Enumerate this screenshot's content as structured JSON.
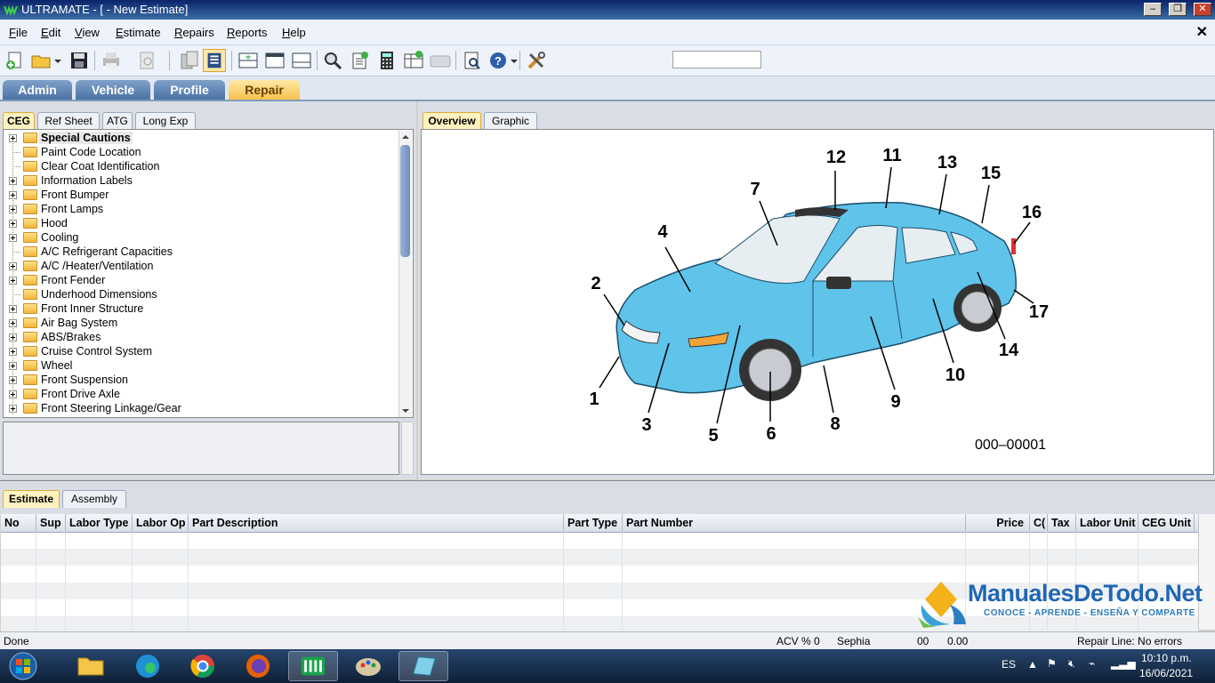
{
  "window": {
    "title": "ULTRAMATE - [ - New Estimate]"
  },
  "menu": [
    {
      "label": "File",
      "u": "F",
      "rest": "ile"
    },
    {
      "label": "Edit",
      "u": "E",
      "rest": "dit"
    },
    {
      "label": "View",
      "u": "V",
      "rest": "iew"
    },
    {
      "label": "Estimate",
      "u": "E",
      "rest": "stimate"
    },
    {
      "label": "Repairs",
      "u": "R",
      "rest": "epairs"
    },
    {
      "label": "Reports",
      "u": "R",
      "rest": "eports"
    },
    {
      "label": "Help",
      "u": "H",
      "rest": "elp"
    }
  ],
  "main_tabs": [
    "Admin",
    "Vehicle",
    "Profile",
    "Repair"
  ],
  "main_tab_active": "Repair",
  "left_tabs": [
    "CEG",
    "Ref Sheet",
    "ATG",
    "Long Exp"
  ],
  "right_tabs": [
    "Overview",
    "Graphic"
  ],
  "tree": [
    {
      "label": "Special Cautions",
      "expandable": true,
      "selected": true
    },
    {
      "label": "Paint Code Location",
      "expandable": false
    },
    {
      "label": "Clear Coat Identification",
      "expandable": false
    },
    {
      "label": "Information Labels",
      "expandable": true
    },
    {
      "label": "Front Bumper",
      "expandable": true
    },
    {
      "label": "Front Lamps",
      "expandable": true
    },
    {
      "label": "Hood",
      "expandable": true
    },
    {
      "label": "Cooling",
      "expandable": true
    },
    {
      "label": "A/C Refrigerant Capacities",
      "expandable": false
    },
    {
      "label": "A/C /Heater/Ventilation",
      "expandable": true
    },
    {
      "label": "Front Fender",
      "expandable": true
    },
    {
      "label": "Underhood Dimensions",
      "expandable": false
    },
    {
      "label": "Front Inner Structure",
      "expandable": true
    },
    {
      "label": "Air Bag System",
      "expandable": true
    },
    {
      "label": "ABS/Brakes",
      "expandable": true
    },
    {
      "label": "Cruise Control System",
      "expandable": true
    },
    {
      "label": "Wheel",
      "expandable": true
    },
    {
      "label": "Front Suspension",
      "expandable": true
    },
    {
      "label": "Front Drive Axle",
      "expandable": true
    },
    {
      "label": "Front Steering Linkage/Gear",
      "expandable": true
    }
  ],
  "diagram": {
    "callouts": [
      "1",
      "2",
      "3",
      "4",
      "5",
      "6",
      "7",
      "8",
      "9",
      "10",
      "11",
      "12",
      "13",
      "14",
      "15",
      "16",
      "17"
    ],
    "code": "000–00001"
  },
  "bottom_tabs": [
    "Estimate",
    "Assembly"
  ],
  "grid_columns": [
    "No",
    "Sup",
    "Labor Type",
    "Labor Op",
    "Part Description",
    "Part Type",
    "Part Number",
    "Price",
    "C(",
    "Tax",
    "Labor Unit",
    "CEG Unit"
  ],
  "watermark": {
    "brand": "ManualesDeTodo.Net",
    "tagline": "CONOCE - APRENDE - ENSEÑA Y COMPARTE"
  },
  "status": {
    "left": "Done",
    "acv": "ACV % 0",
    "paint": "Sephia",
    "val1": "00",
    "val2": "0.00",
    "right": "Repair Line: No errors"
  },
  "taskbar": {
    "lang": "ES",
    "time": "10:10 p.m.",
    "date": "16/06/2021"
  },
  "colors": {
    "car_body": "#5fc3ea",
    "accent_tab": "#f6c24d",
    "title_bar": "#0a246a"
  }
}
